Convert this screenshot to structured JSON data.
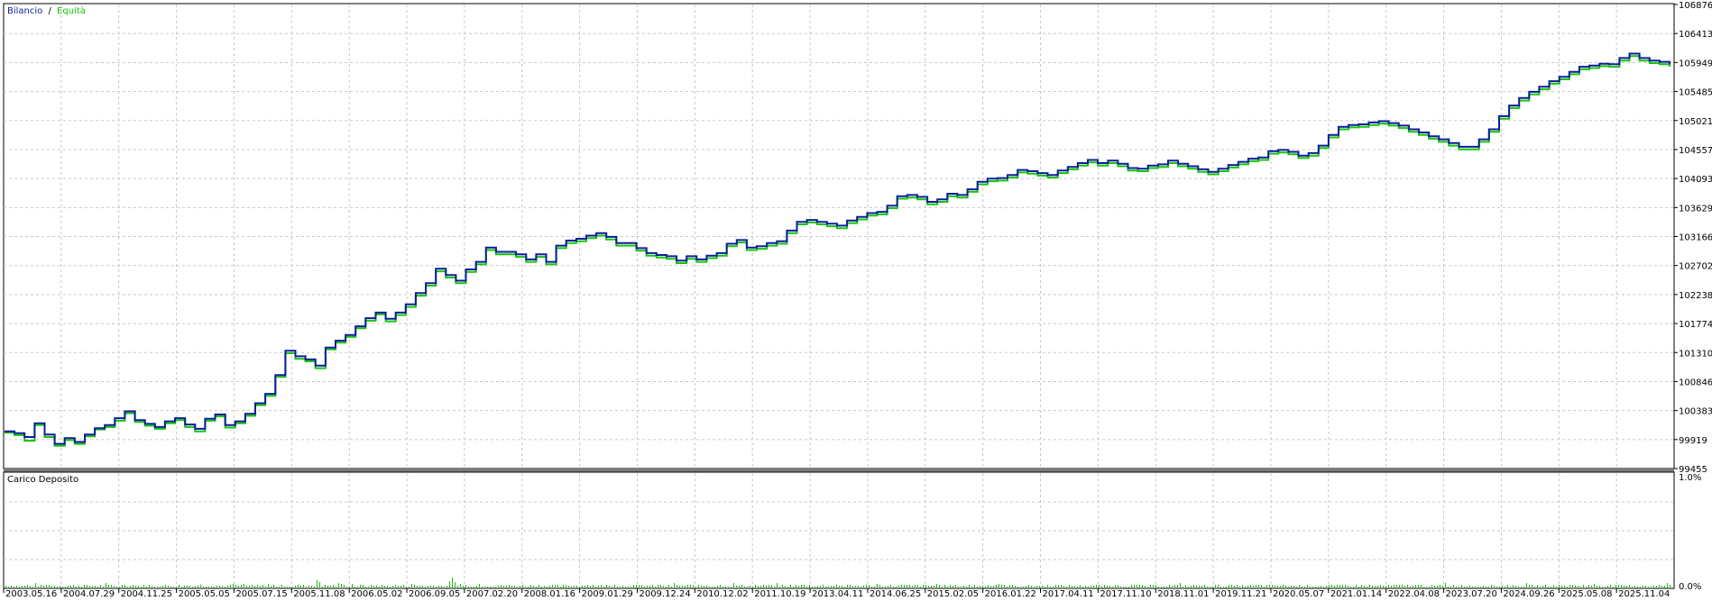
{
  "chart_data": {
    "type": "line",
    "legend": [
      {
        "label": "Bilancio",
        "color": "#0a1e9a"
      },
      {
        "label": "Equità",
        "color": "#16c40b"
      }
    ],
    "legend_separator": "/",
    "y_ticks": [
      "106876",
      "106413",
      "105949",
      "105485",
      "105021",
      "104557",
      "104093",
      "103629",
      "103166",
      "102702",
      "102238",
      "101774",
      "101310",
      "100846",
      "100383",
      "99919",
      "99455"
    ],
    "ylim": [
      99455,
      106876
    ],
    "x_ticks": [
      "2003.05.16",
      "2004.07.29",
      "2004.11.25",
      "2005.05.05",
      "2005.07.15",
      "2005.11.08",
      "2006.05.02",
      "2006.09.05",
      "2007.02.20",
      "2008.01.16",
      "2009.01.29",
      "2009.12.24",
      "2010.12.02",
      "2011.10.19",
      "2013.04.11",
      "2014.06.25",
      "2015.02.05",
      "2016.01.22",
      "2017.04.11",
      "2017.11.10",
      "2018.11.01",
      "2019.11.21",
      "2020.05.07",
      "2021.01.14",
      "2022.04.08",
      "2023.07.20",
      "2024.09.26",
      "2025.05.08",
      "2025.11.04"
    ],
    "series": [
      {
        "name": "Bilancio",
        "values": [
          100050,
          100020,
          99960,
          100180,
          100000,
          99850,
          99940,
          99880,
          100000,
          100100,
          100150,
          100260,
          100370,
          100230,
          100170,
          100120,
          100210,
          100260,
          100160,
          100090,
          100250,
          100320,
          100150,
          100210,
          100330,
          100500,
          100650,
          100950,
          101340,
          101250,
          101200,
          101100,
          101390,
          101500,
          101590,
          101730,
          101860,
          101950,
          101850,
          101950,
          102080,
          102260,
          102420,
          102650,
          102550,
          102460,
          102640,
          102760,
          102990,
          102920,
          102920,
          102880,
          102800,
          102880,
          102760,
          103020,
          103100,
          103130,
          103180,
          103220,
          103160,
          103060,
          103060,
          102980,
          102900,
          102870,
          102850,
          102780,
          102850,
          102800,
          102860,
          102900,
          103050,
          103110,
          102990,
          103010,
          103060,
          103090,
          103260,
          103400,
          103430,
          103400,
          103370,
          103340,
          103420,
          103480,
          103540,
          103560,
          103660,
          103810,
          103830,
          103800,
          103720,
          103760,
          103850,
          103830,
          103920,
          104040,
          104090,
          104100,
          104150,
          104230,
          104210,
          104180,
          104150,
          104220,
          104280,
          104340,
          104390,
          104340,
          104380,
          104330,
          104260,
          104250,
          104300,
          104320,
          104380,
          104330,
          104290,
          104240,
          104200,
          104250,
          104310,
          104360,
          104410,
          104430,
          104530,
          104550,
          104520,
          104460,
          104500,
          104620,
          104790,
          104920,
          104950,
          104960,
          104990,
          105010,
          104980,
          104940,
          104880,
          104830,
          104770,
          104720,
          104660,
          104600,
          104600,
          104720,
          104880,
          105090,
          105260,
          105380,
          105480,
          105560,
          105650,
          105720,
          105800,
          105880,
          105900,
          105930,
          105920,
          106020,
          106090,
          106020,
          105980,
          105960,
          105920
        ]
      },
      {
        "name": "Equità",
        "values": [
          100030,
          99990,
          99900,
          100150,
          99960,
          99820,
          99910,
          99850,
          99970,
          100080,
          100120,
          100220,
          100340,
          100200,
          100140,
          100090,
          100180,
          100230,
          100120,
          100050,
          100220,
          100290,
          100110,
          100180,
          100300,
          100470,
          100620,
          100920,
          101300,
          101210,
          101170,
          101060,
          101360,
          101470,
          101560,
          101700,
          101820,
          101920,
          101810,
          101910,
          102040,
          102220,
          102380,
          102610,
          102510,
          102420,
          102600,
          102720,
          102950,
          102880,
          102880,
          102840,
          102760,
          102840,
          102720,
          102980,
          103060,
          103090,
          103140,
          103180,
          103120,
          103020,
          103020,
          102940,
          102860,
          102830,
          102810,
          102740,
          102810,
          102760,
          102820,
          102860,
          103010,
          103070,
          102950,
          102970,
          103020,
          103050,
          103220,
          103360,
          103390,
          103360,
          103330,
          103300,
          103380,
          103440,
          103500,
          103520,
          103620,
          103770,
          103790,
          103760,
          103680,
          103720,
          103810,
          103790,
          103880,
          104000,
          104050,
          104060,
          104110,
          104190,
          104170,
          104140,
          104110,
          104180,
          104240,
          104300,
          104350,
          104300,
          104340,
          104290,
          104220,
          104210,
          104260,
          104280,
          104340,
          104290,
          104250,
          104200,
          104160,
          104210,
          104270,
          104320,
          104370,
          104390,
          104490,
          104510,
          104480,
          104420,
          104460,
          104580,
          104750,
          104880,
          104910,
          104920,
          104950,
          104970,
          104940,
          104900,
          104840,
          104790,
          104730,
          104680,
          104620,
          104560,
          104560,
          104680,
          104840,
          105050,
          105220,
          105340,
          105440,
          105520,
          105610,
          105680,
          105760,
          105840,
          105860,
          105890,
          105880,
          105980,
          106050,
          105980,
          105940,
          105920,
          105880
        ]
      }
    ]
  },
  "sub_panel": {
    "title": "Carico Deposito",
    "y_ticks": [
      "1.0%",
      "0.0%"
    ]
  }
}
